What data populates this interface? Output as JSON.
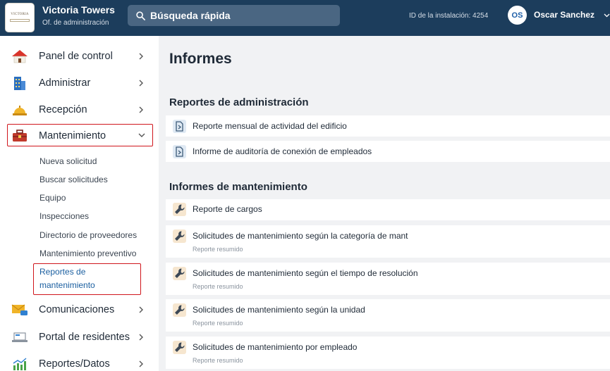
{
  "header": {
    "org_name": "Victoria Towers",
    "org_subtitle": "Of. de administración",
    "logo_text": "VICTORIA",
    "search_placeholder": "Búsqueda rápida",
    "installation_id": "ID de la instalación: 4254",
    "user_initials": "OS",
    "user_name": "Oscar Sanchez"
  },
  "sidebar": {
    "items": [
      {
        "label": "Panel de control",
        "icon": "house-icon"
      },
      {
        "label": "Administrar",
        "icon": "building-icon"
      },
      {
        "label": "Recepción",
        "icon": "reception-bell-icon"
      },
      {
        "label": "Mantenimiento",
        "icon": "toolbox-icon"
      },
      {
        "label": "Comunicaciones",
        "icon": "mail-icon"
      },
      {
        "label": "Portal de residentes",
        "icon": "laptop-icon"
      },
      {
        "label": "Reportes/Datos",
        "icon": "chart-icon"
      }
    ],
    "maintenance_sub": [
      "Nueva solicitud",
      "Buscar solicitudes",
      "Equipo",
      "Inspecciones",
      "Directorio de proveedores",
      "Mantenimiento preventivo"
    ],
    "selected_sub_line1": "Reportes de",
    "selected_sub_line2": "mantenimiento"
  },
  "main": {
    "title": "Informes",
    "admin_section": "Reportes de administración",
    "admin_reports": [
      "Reporte mensual de actividad del edificio",
      "Informe de auditoría de conexión de empleados"
    ],
    "maint_section": "Informes de mantenimiento",
    "maint_reports": [
      {
        "title": "Reporte de cargos",
        "subtitle": ""
      },
      {
        "title": "Solicitudes de mantenimiento según la categoría de mant",
        "subtitle": "Reporte resumido"
      },
      {
        "title": "Solicitudes de mantenimiento según el tiempo de resolución",
        "subtitle": "Reporte resumido"
      },
      {
        "title": "Solicitudes de mantenimiento según la unidad",
        "subtitle": "Reporte resumido"
      },
      {
        "title": "Solicitudes de mantenimiento por empleado",
        "subtitle": "Reporte resumido"
      }
    ]
  },
  "colors": {
    "topbar": "#1c3d5c",
    "highlight_outline": "#d0161c",
    "link_blue": "#1b5fa0"
  }
}
